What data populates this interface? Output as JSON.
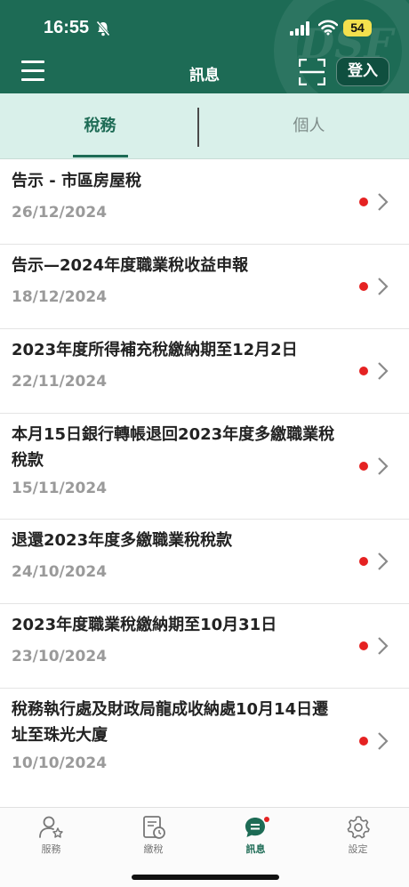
{
  "status_bar": {
    "time": "16:55",
    "battery": "54"
  },
  "header": {
    "title": "訊息",
    "login_label": "登入",
    "watermark": "DSF"
  },
  "tabs": [
    {
      "label": "稅務",
      "active": true
    },
    {
      "label": "個人",
      "active": false
    }
  ],
  "messages": [
    {
      "title": "告示 - 市區房屋稅",
      "date": "26/12/2024",
      "unread": true
    },
    {
      "title": "告示—2024年度職業稅收益申報",
      "date": "18/12/2024",
      "unread": true
    },
    {
      "title": "2023年度所得補充稅繳納期至12月2日",
      "date": "22/11/2024",
      "unread": true
    },
    {
      "title": "本月15日銀行轉帳退回2023年度多繳職業稅稅款",
      "date": "15/11/2024",
      "unread": true
    },
    {
      "title": "退還2023年度多繳職業稅稅款",
      "date": "24/10/2024",
      "unread": true
    },
    {
      "title": "2023年度職業稅繳納期至10月31日",
      "date": "23/10/2024",
      "unread": true
    },
    {
      "title": "稅務執行處及財政局龍成收納處10月14日遷址至珠光大廈",
      "date": "10/10/2024",
      "unread": true
    }
  ],
  "bottom_nav": [
    {
      "label": "服務",
      "icon": "person-star-icon",
      "active": false
    },
    {
      "label": "繳稅",
      "icon": "bill-clock-icon",
      "active": false
    },
    {
      "label": "訊息",
      "icon": "chat-bubble-icon",
      "active": true
    },
    {
      "label": "設定",
      "icon": "gear-icon",
      "active": false
    }
  ],
  "colors": {
    "brand": "#1d6b55",
    "tab_bg": "#d9f0ea",
    "unread": "#e52222",
    "badge": "#f4e04d"
  }
}
